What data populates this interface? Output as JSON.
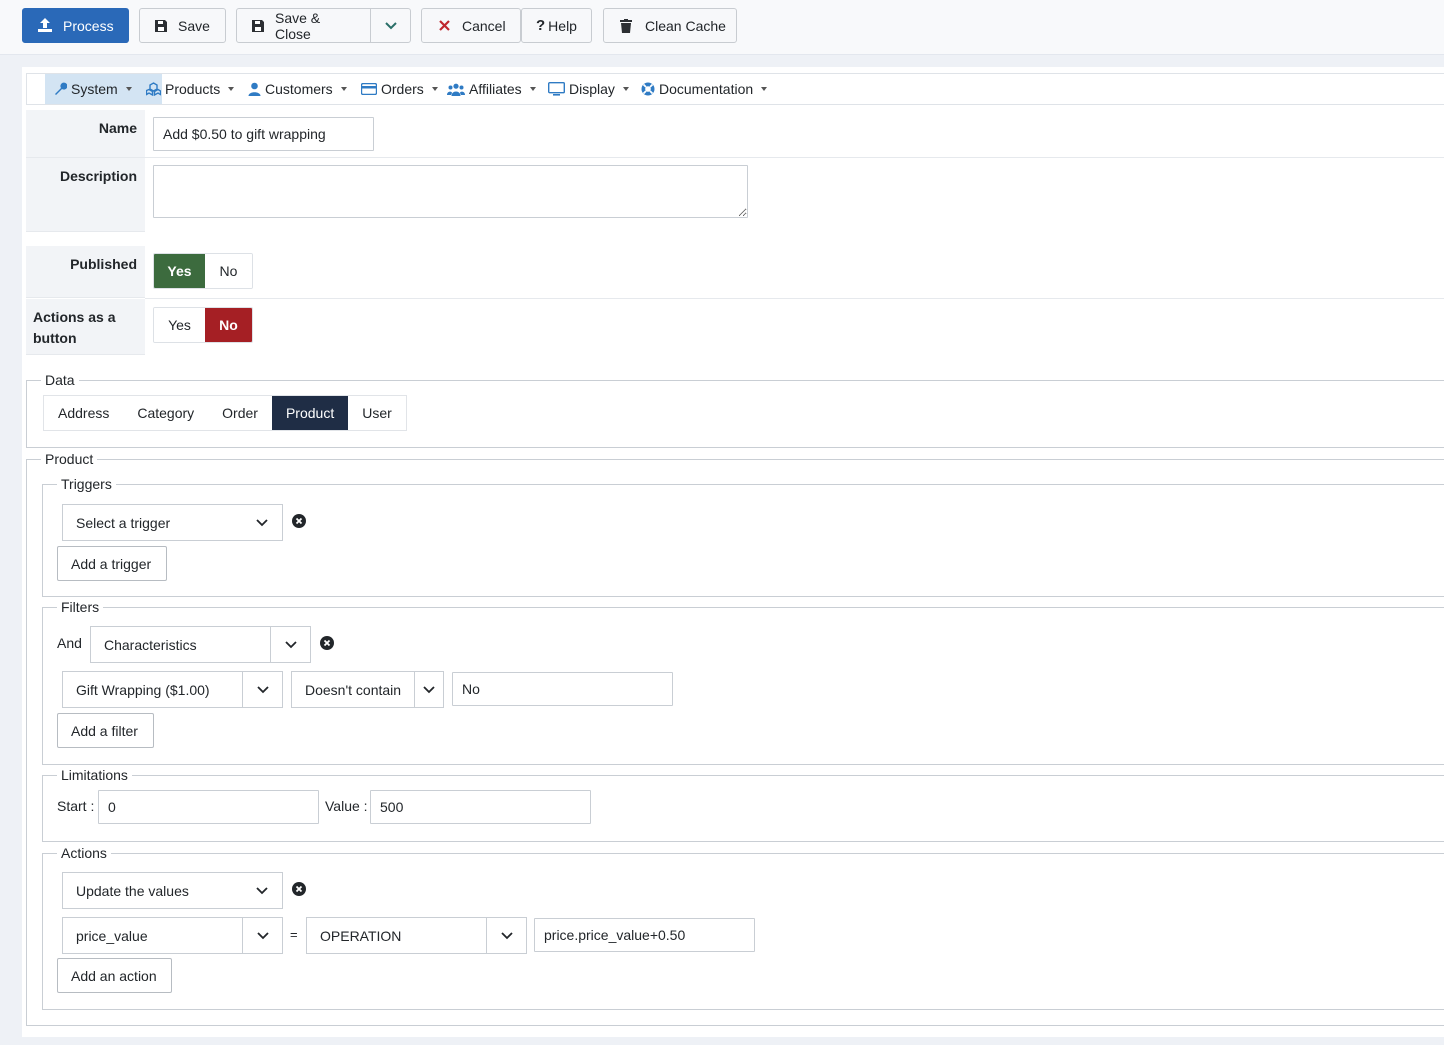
{
  "toolbar": {
    "process": "Process",
    "save": "Save",
    "save_close": "Save & Close",
    "cancel": "Cancel",
    "help": "Help",
    "clean_cache": "Clean Cache"
  },
  "menu": [
    {
      "label": "System",
      "icon": "wrench-icon"
    },
    {
      "label": "Products",
      "icon": "cubes-icon"
    },
    {
      "label": "Customers",
      "icon": "user-icon"
    },
    {
      "label": "Orders",
      "icon": "credit-card-icon"
    },
    {
      "label": "Affiliates",
      "icon": "users-icon"
    },
    {
      "label": "Display",
      "icon": "desktop-icon"
    },
    {
      "label": "Documentation",
      "icon": "lifebuoy-icon"
    }
  ],
  "form": {
    "name_label": "Name",
    "name_value": "Add $0.50 to gift wrapping",
    "description_label": "Description",
    "description_value": "",
    "published_label": "Published",
    "published_yes": "Yes",
    "published_no": "No",
    "actions_button_label": "Actions as a button",
    "actions_button_yes": "Yes",
    "actions_button_no": "No"
  },
  "data_section": {
    "legend": "Data",
    "tabs": [
      "Address",
      "Category",
      "Order",
      "Product",
      "User"
    ],
    "active_tab": "Product"
  },
  "product_section": {
    "legend": "Product",
    "triggers": {
      "legend": "Triggers",
      "select_value": "Select a trigger",
      "add_button": "Add a trigger"
    },
    "filters": {
      "legend": "Filters",
      "conjunction": "And",
      "type_value": "Characteristics",
      "field_value": "Gift Wrapping ($1.00)",
      "operator_value": "Doesn't contain",
      "input_value": "No",
      "add_button": "Add a filter"
    },
    "limitations": {
      "legend": "Limitations",
      "start_label": "Start :",
      "start_value": "0",
      "value_label": "Value :",
      "value_value": "500"
    },
    "actions": {
      "legend": "Actions",
      "select_value": "Update the values",
      "field_value": "price_value",
      "equals": "=",
      "operation_value": "OPERATION",
      "expression_value": "price.price_value+0.50",
      "add_button": "Add an action"
    }
  },
  "colors": {
    "primary": "#2a69b8",
    "yes_active": "#3c6b3e",
    "no_active": "#a51f24",
    "tab_active": "#1f2d45",
    "menu_active": "#d3e4f3"
  }
}
